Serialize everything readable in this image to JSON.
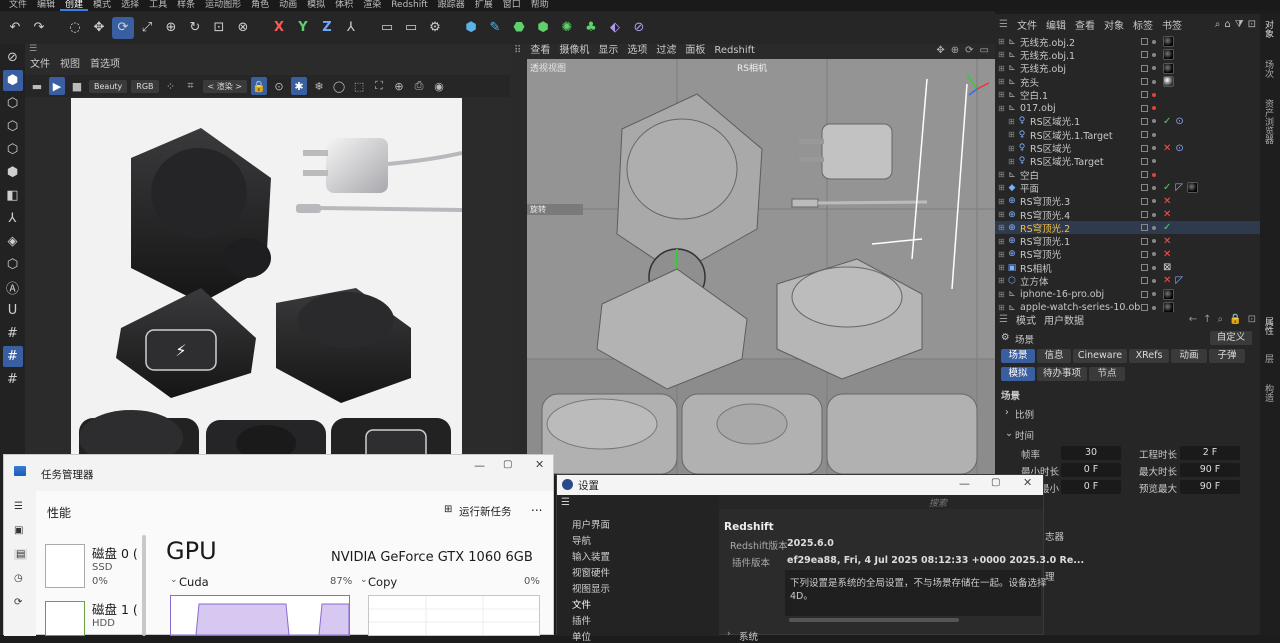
{
  "menubar": [
    "文件",
    "编辑",
    "创建",
    "模式",
    "选择",
    "工具",
    "样条",
    "运动图形",
    "角色",
    "动画",
    "模拟",
    "体积",
    "渲染",
    "Redshift",
    "跟踪器",
    "扩展",
    "窗口",
    "帮助"
  ],
  "menubar_active_index": 2,
  "render_view": {
    "menu": [
      "文件",
      "视图",
      "首选项"
    ],
    "beauty_label": "Beauty",
    "rgb_label": "RGB",
    "render_dropdown": "< 渲染 >"
  },
  "viewport": {
    "menu": [
      "查看",
      "摄像机",
      "显示",
      "选项",
      "过滤",
      "面板",
      "Redshift"
    ],
    "label": "透视视图",
    "camera_label": "RS相机",
    "rotate_label": "旋转"
  },
  "object_manager": {
    "menu": [
      "文件",
      "编辑",
      "查看",
      "对象",
      "标签",
      "书签"
    ],
    "items": [
      {
        "name": "无线充.obj.2",
        "icon": "null",
        "tags": "black-sphere",
        "dot": "gray"
      },
      {
        "name": "无线充.obj.1",
        "icon": "null",
        "tags": "black-sphere",
        "dot": "gray"
      },
      {
        "name": "无线充.obj",
        "icon": "null",
        "tags": "black-sphere",
        "dot": "gray"
      },
      {
        "name": "充头",
        "icon": "null",
        "tags": "white-sphere",
        "dot": "gray"
      },
      {
        "name": "空白.1",
        "icon": "null",
        "tags": "",
        "dot": "red"
      },
      {
        "name": "017.obj",
        "icon": "null",
        "tags": "",
        "dot": "red"
      },
      {
        "name": "RS区域光.1",
        "icon": "light",
        "tags": "check-target",
        "dot": "gray"
      },
      {
        "name": "RS区域光.1.Target",
        "icon": "light",
        "tags": "",
        "dot": "gray"
      },
      {
        "name": "RS区域光",
        "icon": "light",
        "tags": "x-target",
        "dot": "gray"
      },
      {
        "name": "RS区域光.Target",
        "icon": "light",
        "tags": "",
        "dot": "gray"
      },
      {
        "name": "空白",
        "icon": "null",
        "tags": "",
        "dot": "red"
      },
      {
        "name": "平面",
        "icon": "plane",
        "tags": "check-flag-black",
        "dot": "gray"
      },
      {
        "name": "RS穹顶光.3",
        "icon": "dome",
        "tags": "x",
        "dot": "gray"
      },
      {
        "name": "RS穹顶光.4",
        "icon": "dome",
        "tags": "x",
        "dot": "gray"
      },
      {
        "name": "RS穹顶光.2",
        "icon": "dome",
        "tags": "check",
        "dot": "gray",
        "highlight": true
      },
      {
        "name": "RS穹顶光.1",
        "icon": "dome",
        "tags": "x",
        "dot": "gray"
      },
      {
        "name": "RS穹顶光",
        "icon": "dome",
        "tags": "x",
        "dot": "gray"
      },
      {
        "name": "RS相机",
        "icon": "camera",
        "tags": "grid",
        "dot": "gray"
      },
      {
        "name": "立方体",
        "icon": "cube",
        "tags": "x-flag",
        "dot": "gray"
      },
      {
        "name": "iphone-16-pro.obj",
        "icon": "null",
        "tags": "black-sphere",
        "dot": "gray"
      },
      {
        "name": "apple-watch-series-10.obj",
        "icon": "null",
        "tags": "black-sphere",
        "dot": "gray"
      }
    ]
  },
  "attributes": {
    "menu": [
      "模式",
      "用户数据"
    ],
    "scene_header": "场景",
    "custom_dropdown": "自定义",
    "tabs_row1": [
      "场景",
      "信息",
      "Cineware",
      "XRefs",
      "动画",
      "子弹"
    ],
    "tabs_row2": [
      "模拟",
      "待办事项",
      "节点"
    ],
    "section": "场景",
    "group_ratio": "比例",
    "group_time": "时间",
    "fields": [
      {
        "label": "帧率",
        "value": "30"
      },
      {
        "label": "工程时长",
        "value": "2 F"
      },
      {
        "label": "最小时长",
        "value": "0 F"
      },
      {
        "label": "最大时长",
        "value": "90 F"
      },
      {
        "label": "预览最小",
        "value": "0 F"
      },
      {
        "label": "预览最大",
        "value": "90 F"
      }
    ],
    "partial_1": "志器",
    "partial_2": "理"
  },
  "right_tabs": [
    "对象",
    "场次",
    "资产浏览器",
    "属性",
    "层",
    "构造"
  ],
  "task_manager": {
    "title": "任务管理器",
    "section": "性能",
    "run_task": "运行新任务",
    "more": "...",
    "disk0_name": "磁盘 0 (",
    "disk0_type": "SSD",
    "disk0_pct": "0%",
    "disk1_name": "磁盘 1 (",
    "disk1_type": "HDD",
    "gpu_title": "GPU",
    "gpu_name": "NVIDIA GeForce GTX 1060 6GB",
    "cuda_label": "Cuda",
    "cuda_pct": "87%",
    "copy_label": "Copy",
    "copy_pct": "0%"
  },
  "settings": {
    "title": "设置",
    "search_placeholder": "搜索",
    "sidebar": [
      "用户界面",
      "导航",
      "输入装置",
      "视窗硬件",
      "视图显示",
      "文件",
      "插件",
      "单位"
    ],
    "sidebar_selected": "文件",
    "heading": "Redshift",
    "rs_version_label": "Redshift版本",
    "rs_version": "2025.6.0",
    "plugin_version_label": "插件版本",
    "plugin_version": "ef29ea88, Fri, 4 Jul 2025 08:12:33 +0000 2025.3.0 Re...",
    "note": "下列设置是系统的全局设置，不与场景存储在一起。设备选择",
    "note2": "4D。",
    "system_label": "系统"
  },
  "colors": {
    "accent": "#3a5fa0",
    "highlight": "#f2c23a",
    "check": "#52d35a",
    "cross": "#ff4e4e",
    "gpu_chart": "#8a6acf"
  }
}
